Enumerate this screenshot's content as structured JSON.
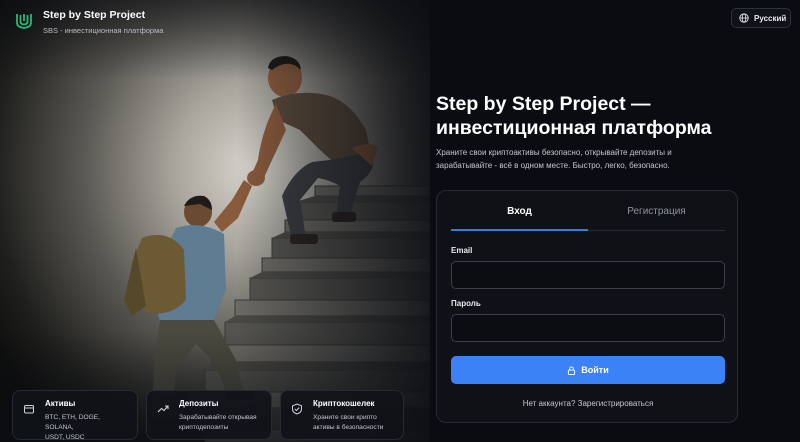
{
  "brand": {
    "name": "Step by Step Project",
    "subtitle": "SBS - инвестиционная платформа",
    "accent_color": "#2bb673"
  },
  "language": {
    "selected": "Русский",
    "icon": "globe-icon"
  },
  "hero": {
    "headline_line1": "Step by Step Project —",
    "headline_line2": "инвестиционная платформа",
    "description": "Храните свои криптоактивы безопасно, открывайте депозиты и зарабатывайте - всё в одном месте. Быстро, легко, безопасно."
  },
  "auth": {
    "tabs": [
      {
        "label": "Вход",
        "active": true
      },
      {
        "label": "Регистрация",
        "active": false
      }
    ],
    "email_label": "Email",
    "email_value": "",
    "password_label": "Пароль",
    "password_value": "",
    "submit_label": "Войти",
    "submit_icon": "lock-icon",
    "register_prompt": "Нет аккаунта? Зарегистрироваться",
    "button_color": "#3b82f6"
  },
  "features": [
    {
      "title": "Активы",
      "text_line1": "BTC, ETH, DOGE, SOLANA,",
      "text_line2": "USDT, USDC",
      "icon": "wallet-icon"
    },
    {
      "title": "Депозиты",
      "text_line1": "Зарабатывайте открывая",
      "text_line2": "криптодепозиты",
      "icon": "trend-up-icon"
    },
    {
      "title": "Криптокошелек",
      "text_line1": "Храните свои крипто",
      "text_line2": "активы в безопасности",
      "icon": "shield-check-icon"
    }
  ]
}
